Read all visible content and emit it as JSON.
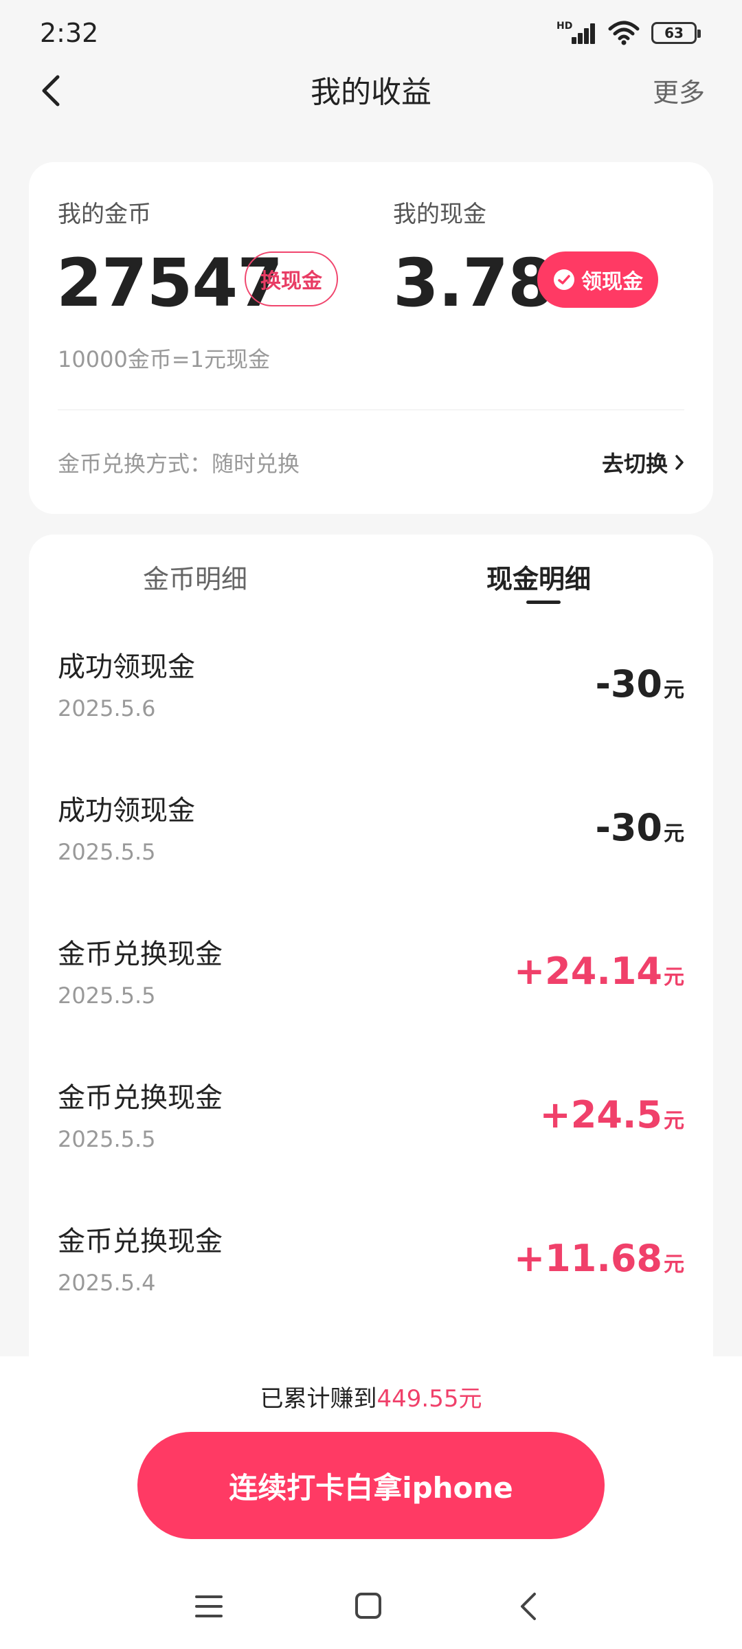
{
  "status_bar": {
    "time": "2:32",
    "network_label": "HD",
    "battery": "63",
    "icons": [
      "signal-icon",
      "wifi-icon",
      "battery-icon"
    ]
  },
  "header": {
    "title": "我的收益",
    "more": "更多",
    "back_icon": "chevron-left-icon"
  },
  "summary": {
    "coins_label": "我的金币",
    "coins_value": "27547",
    "exchange_button": "换现金",
    "cash_label": "我的现金",
    "cash_value": "3.78",
    "withdraw_button": "领现金",
    "withdraw_icon": "wechat-icon",
    "rate_note": "10000金币=1元现金",
    "exchange_mode": "金币兑换方式：随时兑换",
    "switch_link": "去切换"
  },
  "tabs": [
    {
      "label": "金币明细",
      "active": false
    },
    {
      "label": "现金明细",
      "active": true
    }
  ],
  "records": [
    {
      "title": "成功领现金",
      "date": "2025.5.6",
      "amount": "-30",
      "unit": "元",
      "sign": "neg"
    },
    {
      "title": "成功领现金",
      "date": "2025.5.5",
      "amount": "-30",
      "unit": "元",
      "sign": "neg"
    },
    {
      "title": "金币兑换现金",
      "date": "2025.5.5",
      "amount": "+24.14",
      "unit": "元",
      "sign": "pos"
    },
    {
      "title": "金币兑换现金",
      "date": "2025.5.5",
      "amount": "+24.5",
      "unit": "元",
      "sign": "pos"
    },
    {
      "title": "金币兑换现金",
      "date": "2025.5.4",
      "amount": "+11.68",
      "unit": "元",
      "sign": "pos"
    }
  ],
  "footer": {
    "total_prefix": "已累计赚到",
    "total_value": "449.55元",
    "cta": "连续打卡白拿iphone"
  },
  "colors": {
    "accent": "#ff3a64",
    "positive_amount": "#f0406a",
    "background": "#f6f6f6"
  },
  "nav_icons": [
    "menu-icon",
    "home-square-icon",
    "back-triangle-icon"
  ]
}
